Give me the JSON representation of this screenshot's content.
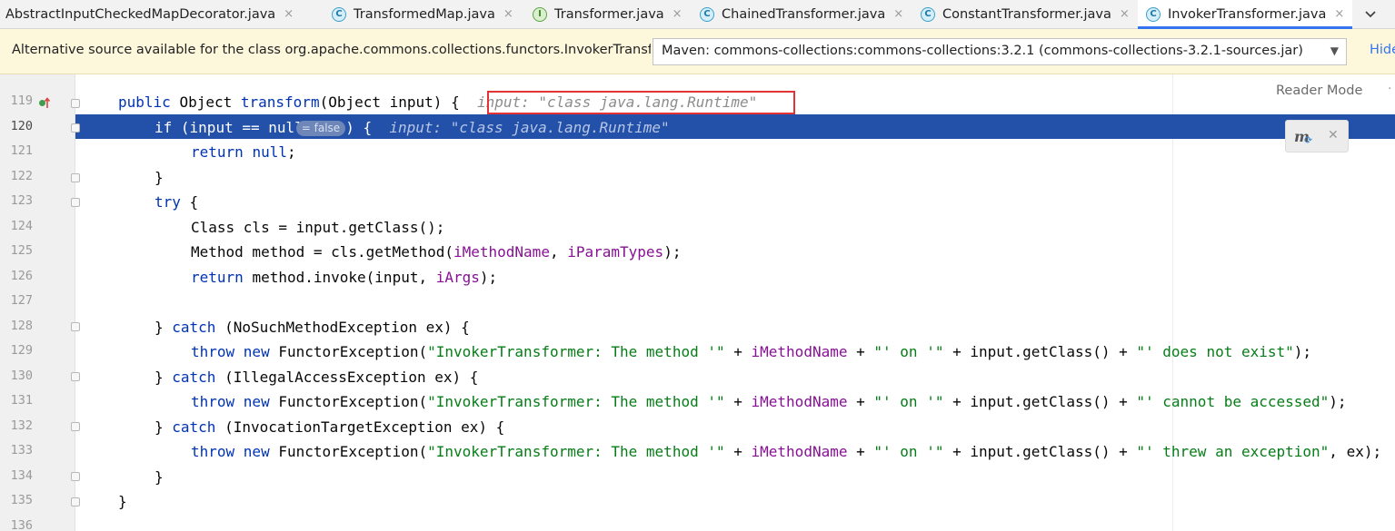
{
  "tabs": [
    {
      "label": "AbstractInputCheckedMapDecorator.java",
      "kind": "",
      "close": "×",
      "active": false
    },
    {
      "label": "TransformedMap.java",
      "kind": "C",
      "close": "×",
      "active": false
    },
    {
      "label": "Transformer.java",
      "kind": "I",
      "close": "×",
      "active": false
    },
    {
      "label": "ChainedTransformer.java",
      "kind": "C",
      "close": "×",
      "active": false
    },
    {
      "label": "ConstantTransformer.java",
      "kind": "C",
      "close": "×",
      "active": false
    },
    {
      "label": "InvokerTransformer.java",
      "kind": "C",
      "close": "×",
      "active": true
    }
  ],
  "tab_menu_icon": "chevron-down-icon",
  "banner": {
    "text": "Alternative source available for the class org.apache.commons.collections.functors.InvokerTransformer",
    "select_value": "Maven: commons-collections:commons-collections:3.2.1 (commons-collections-3.2.1-sources.jar)",
    "hide_label": "Hide"
  },
  "editor": {
    "reader_mode_label": "Reader Mode",
    "current_line": 120,
    "lines": [
      {
        "n": "119",
        "indent": 4,
        "parts": [
          [
            "kw",
            "public "
          ],
          [
            "",
            "Object "
          ],
          [
            "kw",
            "transform"
          ],
          [
            "",
            "(Object input) {  "
          ]
        ],
        "hint": "input: \"class java.lang.Runtime\""
      },
      {
        "n": "120",
        "indent": 8,
        "parts": [
          [
            "kw",
            "if "
          ],
          [
            "",
            "(input == null"
          ]
        ],
        "chip": "= false",
        "after_chip": ") {  ",
        "hint": "input: \"class java.lang.Runtime\""
      },
      {
        "n": "121",
        "indent": 12,
        "parts": [
          [
            "kw",
            "return "
          ],
          [
            "kw",
            "null"
          ],
          [
            "",
            ";"
          ]
        ]
      },
      {
        "n": "122",
        "indent": 8,
        "parts": [
          [
            "",
            "}"
          ]
        ]
      },
      {
        "n": "123",
        "indent": 8,
        "parts": [
          [
            "kw",
            "try "
          ],
          [
            "",
            "{"
          ]
        ]
      },
      {
        "n": "124",
        "indent": 12,
        "parts": [
          [
            "",
            "Class cls = input.getClass();"
          ]
        ]
      },
      {
        "n": "125",
        "indent": 12,
        "parts": [
          [
            "",
            "Method method = cls.getMethod("
          ],
          [
            "fld",
            "iMethodName"
          ],
          [
            "",
            ", "
          ],
          [
            "fld",
            "iParamTypes"
          ],
          [
            "",
            ");"
          ]
        ]
      },
      {
        "n": "126",
        "indent": 12,
        "parts": [
          [
            "kw",
            "return "
          ],
          [
            "",
            "method.invoke(input, "
          ],
          [
            "fld",
            "iArgs"
          ],
          [
            "",
            ");"
          ]
        ]
      },
      {
        "n": "127",
        "indent": 0,
        "parts": []
      },
      {
        "n": "128",
        "indent": 8,
        "parts": [
          [
            "",
            "} "
          ],
          [
            "kw",
            "catch "
          ],
          [
            "",
            "(NoSuchMethodException ex) {"
          ]
        ]
      },
      {
        "n": "129",
        "indent": 12,
        "parts": [
          [
            "kw",
            "throw new "
          ],
          [
            "",
            "FunctorException("
          ],
          [
            "str",
            "\"InvokerTransformer: The method '\""
          ],
          [
            "",
            " + "
          ],
          [
            "fld",
            "iMethodName"
          ],
          [
            "",
            " + "
          ],
          [
            "str",
            "\"' on '\""
          ],
          [
            "",
            " + input.getClass() + "
          ],
          [
            "str",
            "\"' does not exist\""
          ],
          [
            "",
            ");"
          ]
        ]
      },
      {
        "n": "130",
        "indent": 8,
        "parts": [
          [
            "",
            "} "
          ],
          [
            "kw",
            "catch "
          ],
          [
            "",
            "(IllegalAccessException ex) {"
          ]
        ]
      },
      {
        "n": "131",
        "indent": 12,
        "parts": [
          [
            "kw",
            "throw new "
          ],
          [
            "",
            "FunctorException("
          ],
          [
            "str",
            "\"InvokerTransformer: The method '\""
          ],
          [
            "",
            " + "
          ],
          [
            "fld",
            "iMethodName"
          ],
          [
            "",
            " + "
          ],
          [
            "str",
            "\"' on '\""
          ],
          [
            "",
            " + input.getClass() + "
          ],
          [
            "str",
            "\"' cannot be accessed\""
          ],
          [
            "",
            ");"
          ]
        ]
      },
      {
        "n": "132",
        "indent": 8,
        "parts": [
          [
            "",
            "} "
          ],
          [
            "kw",
            "catch "
          ],
          [
            "",
            "(InvocationTargetException ex) {"
          ]
        ]
      },
      {
        "n": "133",
        "indent": 12,
        "parts": [
          [
            "kw",
            "throw new "
          ],
          [
            "",
            "FunctorException("
          ],
          [
            "str",
            "\"InvokerTransformer: The method '\""
          ],
          [
            "",
            " + "
          ],
          [
            "fld",
            "iMethodName"
          ],
          [
            "",
            " + "
          ],
          [
            "str",
            "\"' on '\""
          ],
          [
            "",
            " + input.getClass() + "
          ],
          [
            "str",
            "\"' threw an exception\""
          ],
          [
            "",
            ", ex);"
          ]
        ]
      },
      {
        "n": "134",
        "indent": 8,
        "parts": [
          [
            "",
            "}"
          ]
        ]
      },
      {
        "n": "135",
        "indent": 4,
        "parts": [
          [
            "",
            "}"
          ]
        ]
      },
      {
        "n": "136",
        "indent": 0,
        "parts": []
      }
    ]
  },
  "colors": {
    "keyword": "#0033b3",
    "field": "#871094",
    "string": "#067d17",
    "current_line": "#2350a8",
    "annotation_box": "#e23434"
  }
}
